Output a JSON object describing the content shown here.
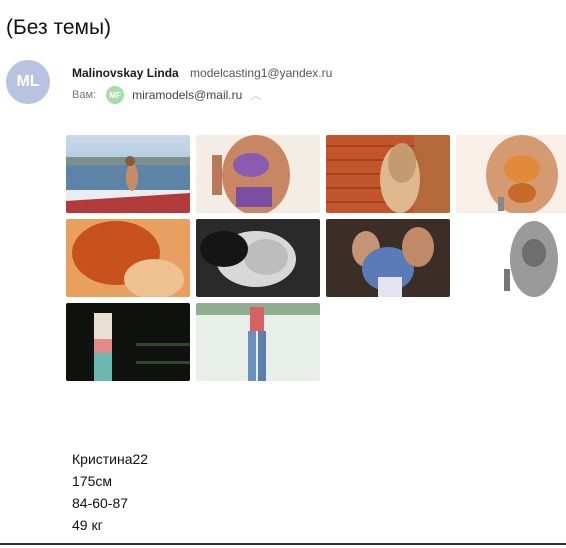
{
  "subject": "(Без темы)",
  "sender": {
    "initials": "ML",
    "name": "Malinovskay Linda",
    "email": "modelcasting1@yandex.ru",
    "avatar_color": "#b8c3e1"
  },
  "recipient": {
    "label": "Вам:",
    "initials": "MF",
    "email": "miramodels@mail.ru",
    "avatar_color": "#a8dcaa"
  },
  "attachments": [
    {
      "icon": "photo-yacht-beach"
    },
    {
      "icon": "photo-swimsuit-purple"
    },
    {
      "icon": "photo-brick-wall"
    },
    {
      "icon": "photo-swimsuit-orange"
    },
    {
      "icon": "photo-orange-hair"
    },
    {
      "icon": "photo-black-white-portrait"
    },
    {
      "icon": "photo-party-group"
    },
    {
      "icon": "photo-monochrome-figure"
    },
    {
      "icon": "photo-night-dress"
    },
    {
      "icon": "photo-jeans-outdoor"
    }
  ],
  "body_lines": [
    "Кристина22",
    "175см",
    "84-60-87",
    "49 кг"
  ]
}
